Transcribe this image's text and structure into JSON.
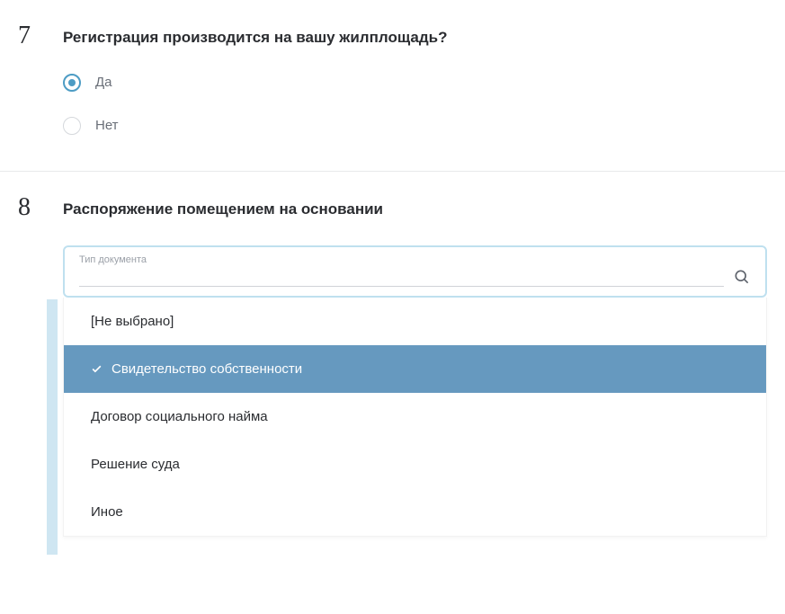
{
  "q7": {
    "number": "7",
    "title": "Регистрация производится на вашу жилплощадь?",
    "options": [
      {
        "label": "Да",
        "checked": true
      },
      {
        "label": "Нет",
        "checked": false
      }
    ]
  },
  "q8": {
    "number": "8",
    "title": "Распоряжение помещением на основании",
    "dropdown": {
      "floating_label": "Тип документа",
      "value": "",
      "options": [
        {
          "label": "[Не выбрано]",
          "selected": false
        },
        {
          "label": "Свидетельство собственности",
          "selected": true
        },
        {
          "label": "Договор социального найма",
          "selected": false
        },
        {
          "label": "Решение суда",
          "selected": false
        },
        {
          "label": "Иное",
          "selected": false
        }
      ]
    }
  }
}
